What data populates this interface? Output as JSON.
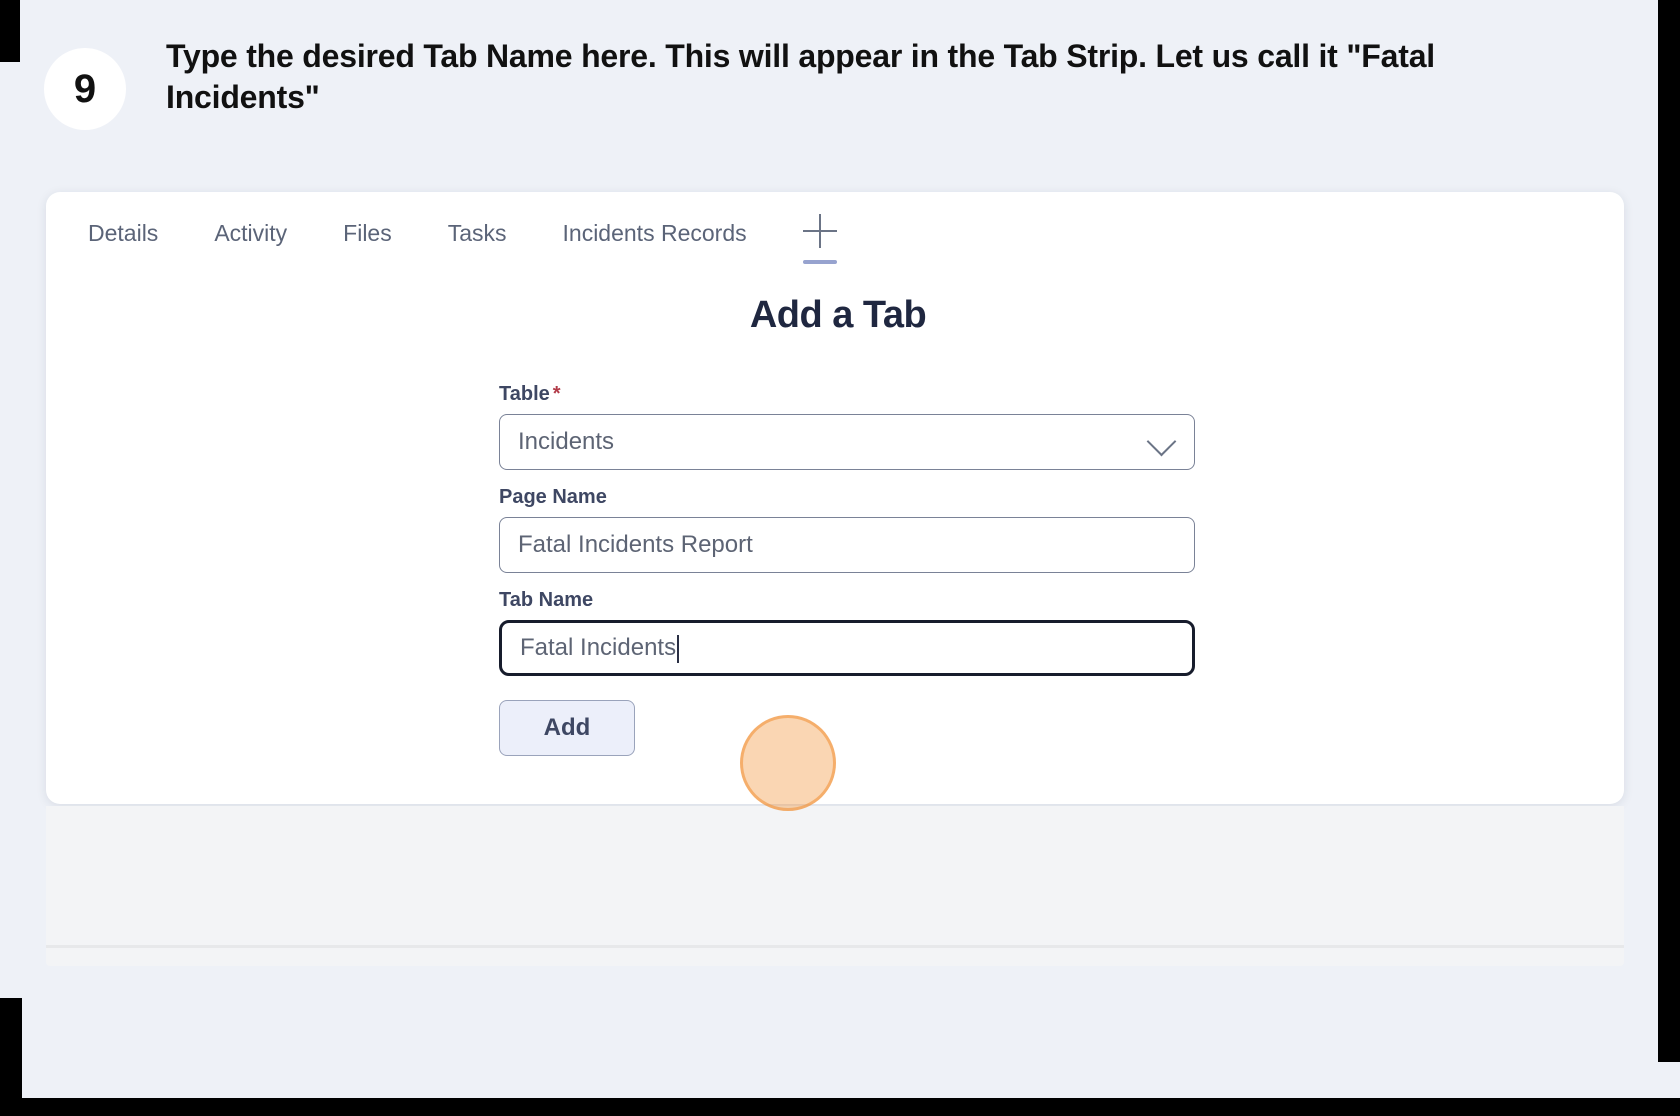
{
  "callout": {
    "step_number": "9",
    "text": "Type the desired Tab Name here. This will appear in the Tab Strip. Let us call it \"Fatal Incidents\""
  },
  "tabs": {
    "items": [
      {
        "label": "Details",
        "active": false
      },
      {
        "label": "Activity",
        "active": false
      },
      {
        "label": "Files",
        "active": false
      },
      {
        "label": "Tasks",
        "active": false
      },
      {
        "label": "Incidents Records",
        "active": false
      }
    ],
    "add_tab_icon": "plus-icon"
  },
  "form": {
    "title": "Add a Tab",
    "fields": {
      "table": {
        "label": "Table",
        "required_marker": "*",
        "value": "Incidents",
        "dropdown_icon": "chevron-down-icon"
      },
      "page_name": {
        "label": "Page Name",
        "value": "Fatal Incidents Report"
      },
      "tab_name": {
        "label": "Tab Name",
        "value": "Fatal Incidents",
        "focused": true
      }
    },
    "submit_label": "Add"
  },
  "colors": {
    "page_background": "#eef1f7",
    "card_background": "#ffffff",
    "label_text": "#3e4763",
    "muted_text": "#5b6478",
    "required_star": "#b23a48",
    "tab_indicator": "#97a3cf",
    "button_background": "#eceffa",
    "focus_border": "#171c2c",
    "click_highlight": "#f39237"
  }
}
